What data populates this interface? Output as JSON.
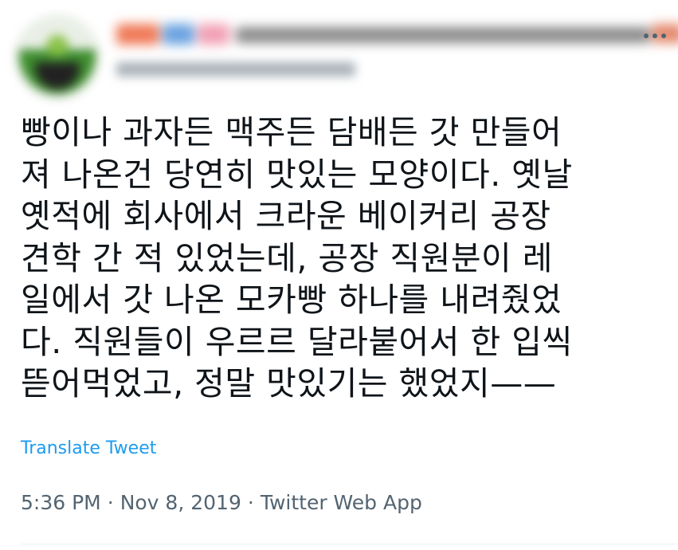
{
  "tweet": {
    "text_lines": [
      "빵이나 과자든 맥주든 담배든 갓 만들어",
      "져 나온건 당연히 맛있는 모양이다. 옛날",
      "옛적에 회사에서 크라운 베이커리 공장",
      "견학 간 적 있었는데, 공장 직원분이 레",
      "일에서 갓 나온 모카빵 하나를 내려줬었",
      "다. 직원들이 우르르 달라붙어서 한 입씩",
      "뜯어먹었고, 정말 맛있기는 했었지——"
    ],
    "translate_label": "Translate Tweet",
    "time": "5:36 PM",
    "date": "Nov 8, 2019",
    "source": "Twitter Web App",
    "separator": "·"
  },
  "icons": {
    "more": "more-horizontal-icon"
  },
  "colors": {
    "text": "#0f1419",
    "secondary": "#536471",
    "link": "#1d9bf0"
  }
}
